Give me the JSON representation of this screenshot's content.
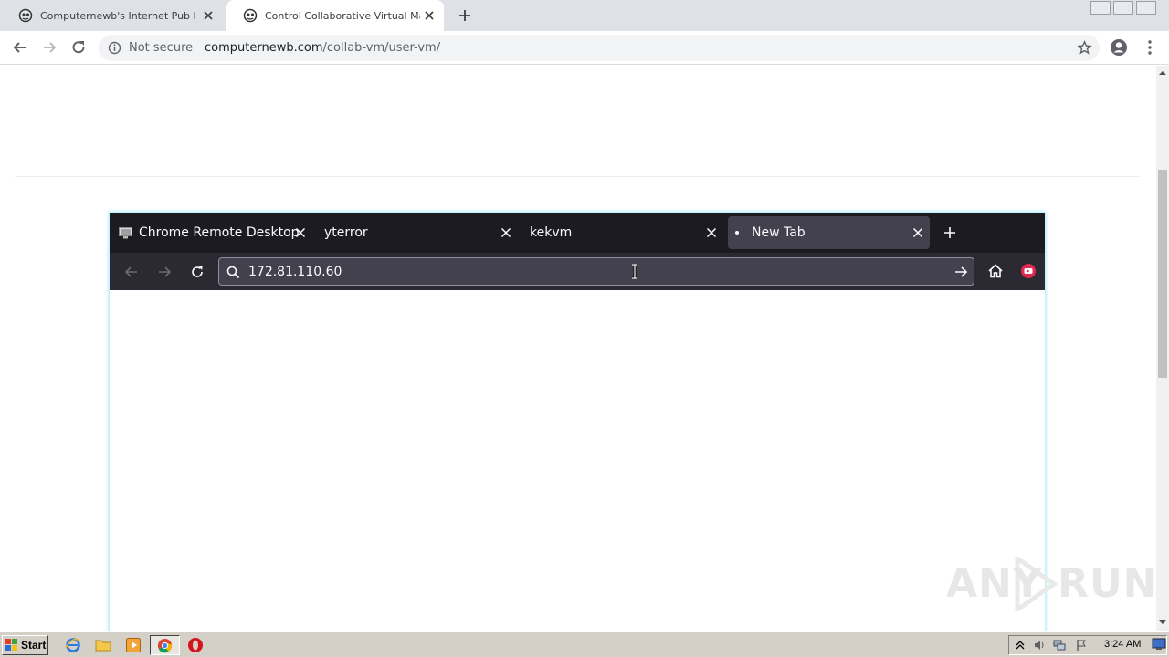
{
  "browser": {
    "tabs": [
      {
        "title": "Computernewb's Internet Pub Hub",
        "active": false,
        "icon": "computernewb-favicon"
      },
      {
        "title": "Control Collaborative Virtual Machine",
        "active": true,
        "icon": "computernewb-favicon"
      }
    ],
    "omnibox": {
      "security_label": "Not secure",
      "url_host": "computernewb.com",
      "url_path": "/collab-vm/user-vm/"
    }
  },
  "vm": {
    "tabs": [
      {
        "title": "Chrome Remote Desktop",
        "icon": "chrome-remote-desktop-icon"
      },
      {
        "title": "yterror"
      },
      {
        "title": "kekvm"
      },
      {
        "title": "New Tab",
        "active": true
      }
    ],
    "urlbar_value": "172.81.110.60",
    "colors": {
      "tabbar": "#1c1b22",
      "navbar": "#2b2a33",
      "active_tab": "#42414d",
      "extension_badge": "#e22850"
    }
  },
  "watermark": {
    "text": "ANY RUN"
  },
  "taskbar": {
    "start_label": "Start",
    "quick_launch": [
      "internet-explorer-icon",
      "folder-icon",
      "media-player-icon"
    ],
    "tasks": [
      "chrome-icon",
      "opera-icon"
    ],
    "clock": "3:24 AM"
  }
}
